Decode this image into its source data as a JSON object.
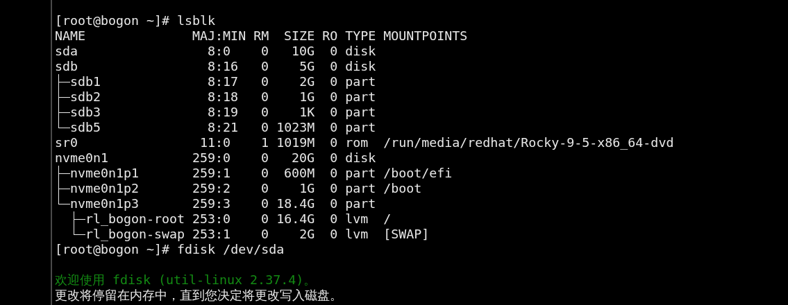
{
  "terminal": {
    "blocks": [
      {
        "kind": "prompt",
        "text": "[root@bogon ~]# lsblk"
      },
      {
        "kind": "table",
        "columns": [
          "NAME",
          "MAJ:MIN",
          "RM",
          "SIZE",
          "RO",
          "TYPE",
          "MOUNTPOINTS"
        ],
        "rows": [
          {
            "name": "sda",
            "maj_min": "8:0",
            "rm": "0",
            "size": "10G",
            "ro": "0",
            "type": "disk"
          },
          {
            "name": "sdb",
            "maj_min": "8:16",
            "rm": "0",
            "size": "5G",
            "ro": "0",
            "type": "disk",
            "children": [
              {
                "name": "sdb1",
                "maj_min": "8:17",
                "rm": "0",
                "size": "2G",
                "ro": "0",
                "type": "part"
              },
              {
                "name": "sdb2",
                "maj_min": "8:18",
                "rm": "0",
                "size": "1G",
                "ro": "0",
                "type": "part"
              },
              {
                "name": "sdb3",
                "maj_min": "8:19",
                "rm": "0",
                "size": "1K",
                "ro": "0",
                "type": "part"
              },
              {
                "name": "sdb5",
                "maj_min": "8:21",
                "rm": "0",
                "size": "1023M",
                "ro": "0",
                "type": "part"
              }
            ]
          },
          {
            "name": "sr0",
            "maj_min": "11:0",
            "rm": "1",
            "size": "1019M",
            "ro": "0",
            "type": "rom",
            "mountpoint": "/run/media/redhat/Rocky-9-5-x86_64-dvd"
          },
          {
            "name": "nvme0n1",
            "maj_min": "259:0",
            "rm": "0",
            "size": "20G",
            "ro": "0",
            "type": "disk",
            "children": [
              {
                "name": "nvme0n1p1",
                "maj_min": "259:1",
                "rm": "0",
                "size": "600M",
                "ro": "0",
                "type": "part",
                "mountpoint": "/boot/efi"
              },
              {
                "name": "nvme0n1p2",
                "maj_min": "259:2",
                "rm": "0",
                "size": "1G",
                "ro": "0",
                "type": "part",
                "mountpoint": "/boot"
              },
              {
                "name": "nvme0n1p3",
                "maj_min": "259:3",
                "rm": "0",
                "size": "18.4G",
                "ro": "0",
                "type": "part",
                "children": [
                  {
                    "name": "rl_bogon-root",
                    "maj_min": "253:0",
                    "rm": "0",
                    "size": "16.4G",
                    "ro": "0",
                    "type": "lvm",
                    "mountpoint": "/"
                  },
                  {
                    "name": "rl_bogon-swap",
                    "maj_min": "253:1",
                    "rm": "0",
                    "size": "2G",
                    "ro": "0",
                    "type": "lvm",
                    "mountpoint": "[SWAP]"
                  }
                ]
              }
            ]
          }
        ]
      },
      {
        "kind": "prompt",
        "text": "[root@bogon ~]# fdisk /dev/sda"
      },
      {
        "kind": "blank"
      },
      {
        "kind": "welcome",
        "text": "欢迎使用 fdisk (util-linux 2.37.4)。"
      },
      {
        "kind": "output",
        "text": "更改将停留在内存中，直到您决定将更改写入磁盘。"
      }
    ]
  }
}
